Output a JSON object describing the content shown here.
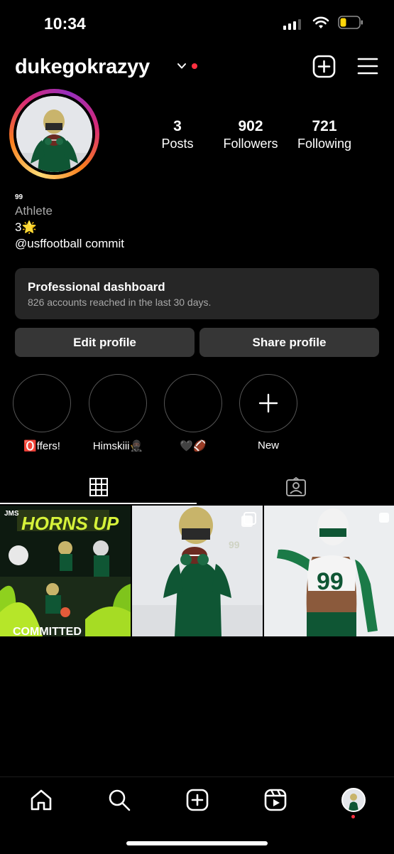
{
  "status_bar": {
    "time": "10:34"
  },
  "header": {
    "username": "dukegokrazyy"
  },
  "stats": [
    {
      "value": "3",
      "label": "Posts"
    },
    {
      "value": "902",
      "label": "Followers"
    },
    {
      "value": "721",
      "label": "Following"
    }
  ],
  "bio": {
    "small_text": "99",
    "category": "Athlete",
    "line1": "3🌟",
    "line2": "@usffootball commit"
  },
  "dashboard": {
    "title": "Professional dashboard",
    "subtitle": "826 accounts reached in the last 30 days."
  },
  "buttons": {
    "edit": "Edit profile",
    "share": "Share profile"
  },
  "highlights": [
    {
      "label": "🅾️ffers!"
    },
    {
      "label": "Himskiii🥷🏿"
    },
    {
      "label": "🖤🏈"
    },
    {
      "label": "New"
    }
  ],
  "posts": [
    {
      "headline": "HORNS UP",
      "tag": "JMS",
      "footer": "COMMITTED"
    },
    {
      "jersey": "99"
    },
    {
      "jersey": "99"
    }
  ],
  "colors": {
    "accent_red": "#ff3040",
    "usf_green": "#0d5a36",
    "gold": "#c8b46a"
  },
  "icons": [
    "signal-icon",
    "wifi-icon",
    "battery-icon",
    "chevron-down-icon",
    "add-post-icon",
    "menu-icon",
    "grid-icon",
    "tagged-icon",
    "home-icon",
    "search-icon",
    "create-icon",
    "reels-icon",
    "profile-avatar-icon"
  ]
}
